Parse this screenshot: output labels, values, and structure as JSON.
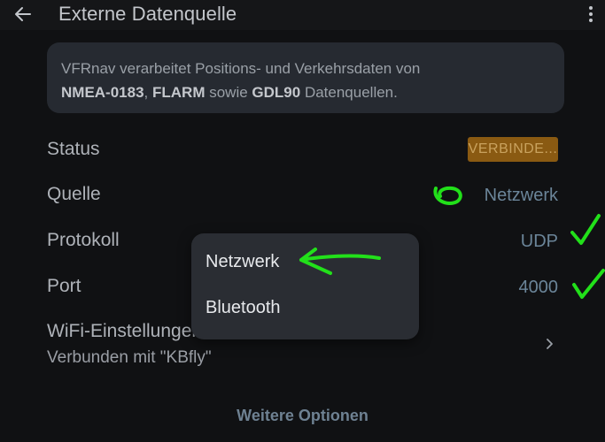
{
  "header": {
    "title": "Externe Datenquelle",
    "back_icon": "arrow-left-icon",
    "menu_icon": "more-vert-icon"
  },
  "info": {
    "line1": "VFRnav verarbeitet Positions- und Verkehrsdaten von",
    "proto1": "NMEA-0183",
    "sep": ",",
    "proto2": "FLARM",
    "mid": " sowie ",
    "proto3": "GDL90",
    "tail": " Datenquellen."
  },
  "rows": {
    "status": {
      "label": "Status",
      "value": "VERBINDE..."
    },
    "source": {
      "label": "Quelle",
      "value": "Netzwerk"
    },
    "protocol": {
      "label": "Protokoll",
      "value": "UDP"
    },
    "port": {
      "label": "Port",
      "value": "4000"
    },
    "wifi": {
      "label": "WiFi-Einstellungen",
      "sub": "Verbunden mit \"KBfly\""
    }
  },
  "dropdown": {
    "options": [
      "Netzwerk",
      "Bluetooth"
    ]
  },
  "footer": {
    "more_options": "Weitere Optionen"
  },
  "colors": {
    "background": "#101113",
    "badge": "#8a5a12",
    "value": "#6b8599",
    "annotation": "#22e01a"
  }
}
